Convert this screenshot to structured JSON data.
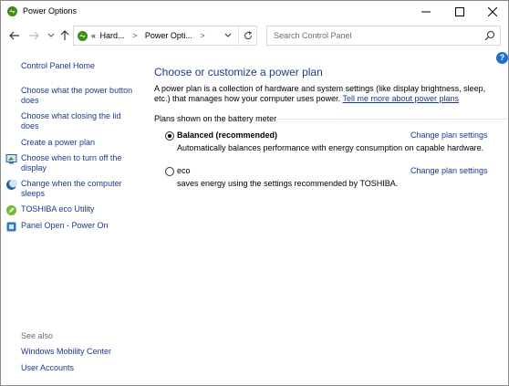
{
  "window": {
    "title": "Power Options",
    "minimize_icon": "minimize-icon",
    "maximize_icon": "maximize-icon",
    "close_icon": "close-icon"
  },
  "nav": {
    "back_icon": "arrow-left-icon",
    "forward_icon": "arrow-right-icon",
    "recent_icon": "chevron-down-icon",
    "up_icon": "arrow-up-icon",
    "address": {
      "prefix": "«",
      "crumb1": "Hard...",
      "separator": ">",
      "crumb2": "Power Opti...",
      "separator2": ">"
    },
    "search_placeholder": "Search Control Panel"
  },
  "sidebar": {
    "home": "Control Panel Home",
    "links": [
      {
        "label": "Choose what the power button\ndoes"
      },
      {
        "label": "Choose what closing the lid\ndoes"
      },
      {
        "label": "Create a power plan"
      },
      {
        "label": "Choose when to turn off the\ndisplay",
        "icon": "monitor-icon"
      },
      {
        "label": "Change when the computer\nsleeps",
        "icon": "moon-icon"
      },
      {
        "label": "TOSHIBA eco Utility",
        "icon": "leaf-icon"
      },
      {
        "label": "Panel Open - Power On",
        "icon": "panel-icon"
      }
    ],
    "see_also_label": "See also",
    "see_also": [
      {
        "label": "Windows Mobility Center"
      },
      {
        "label": "User Accounts"
      }
    ]
  },
  "main": {
    "heading": "Choose or customize a power plan",
    "description": "A power plan is a collection of hardware and system settings (like display brightness, sleep, etc.) that manages how your computer uses power.",
    "learn_more": "Tell me more about power plans",
    "group_label": "Plans shown on the battery meter",
    "plans": [
      {
        "name": "Balanced (recommended)",
        "description": "Automatically balances performance with energy consumption on capable hardware.",
        "link": "Change plan settings",
        "selected": true
      },
      {
        "name": "eco",
        "description": "saves energy using the settings recommended by TOSHIBA.",
        "link": "Change plan settings",
        "selected": false
      }
    ],
    "help_label": "?"
  }
}
